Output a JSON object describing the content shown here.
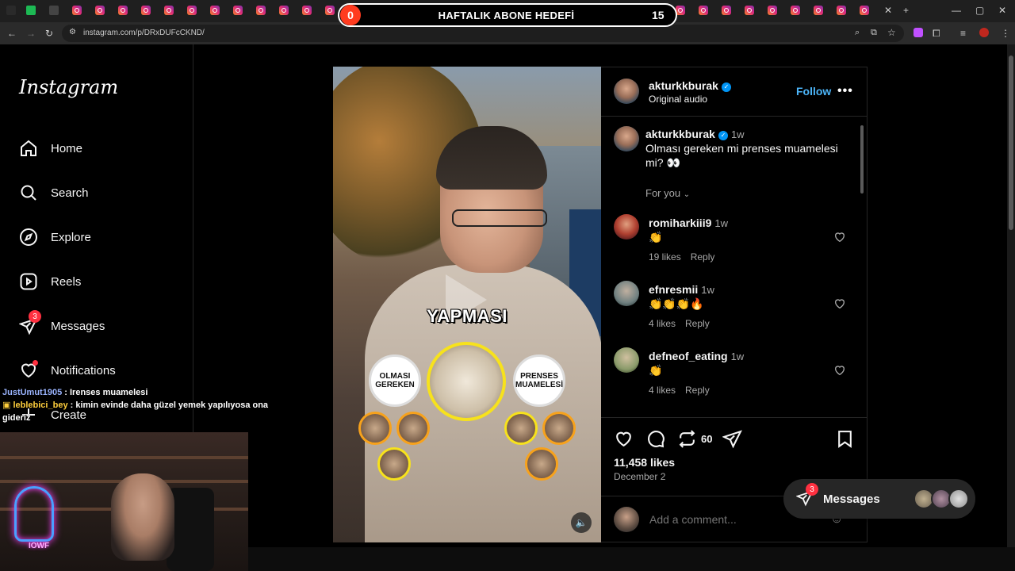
{
  "browser": {
    "url": "instagram.com/p/DRxDUFcCKND/"
  },
  "overlay": {
    "goal_current": "0",
    "goal_title": "HAFTALIK ABONE HEDEFİ",
    "goal_target": "15"
  },
  "sidebar": {
    "logo": "Instagram",
    "items": [
      {
        "label": "Home",
        "icon": "home-icon"
      },
      {
        "label": "Search",
        "icon": "search-icon"
      },
      {
        "label": "Explore",
        "icon": "compass-icon"
      },
      {
        "label": "Reels",
        "icon": "reels-icon"
      },
      {
        "label": "Messages",
        "icon": "messenger-icon",
        "badge": "3"
      },
      {
        "label": "Notifications",
        "icon": "heart-icon"
      },
      {
        "label": "Create",
        "icon": "plus-icon"
      }
    ]
  },
  "stream_chat": [
    {
      "user": "JustUmut1905",
      "text": ": Irenses muamelesi"
    },
    {
      "user": "leblebici_bey",
      "text": ": kimin evinde daha güzel yemek yapılıyosa ona gideriz"
    }
  ],
  "video": {
    "caption_word": "YAPMASI",
    "left_circle": "OLMASI GEREKEN",
    "right_circle": "PRENSES MUAMELESİ"
  },
  "post": {
    "author": "akturkkburak",
    "audio": "Original audio",
    "follow_label": "Follow",
    "caption_time": "1w",
    "caption": "Olması gereken mi prenses muamelesi mi? 👀",
    "for_you": "For you",
    "repost_count": "60",
    "likes": "11,458 likes",
    "date": "December 2",
    "add_comment_placeholder": "Add a comment..."
  },
  "comments": [
    {
      "user": "romiharkiii9",
      "time": "1w",
      "text": "👏",
      "likes": "19 likes",
      "reply": "Reply"
    },
    {
      "user": "efnresmii",
      "time": "1w",
      "text": "👏👏👏🔥",
      "likes": "4 likes",
      "reply": "Reply"
    },
    {
      "user": "defneof_eating",
      "time": "1w",
      "text": "👏",
      "likes": "4 likes",
      "reply": "Reply"
    }
  ],
  "messages_pill": {
    "label": "Messages",
    "badge": "3"
  },
  "colors": {
    "accent": "#0095f6",
    "follow": "#4cb5f9",
    "badge": "#ff3040"
  }
}
